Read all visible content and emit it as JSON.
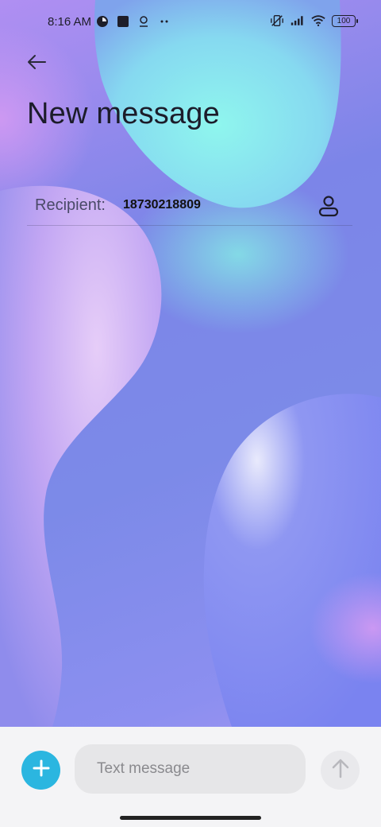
{
  "status_bar": {
    "time": "8:16 AM",
    "left_icons": [
      "notification-app-icon",
      "square-app-icon",
      "location-icon",
      "more-dots-icon"
    ],
    "right_icons": [
      "vibrate-off-icon",
      "signal-icon",
      "wifi-icon"
    ],
    "battery": "100"
  },
  "header": {
    "back_icon": "arrow-left-icon",
    "title": "New message"
  },
  "recipient": {
    "label": "Recipient:",
    "value": "18730218809",
    "contact_icon": "person-icon"
  },
  "composer": {
    "add_icon": "plus-icon",
    "placeholder": "Text message",
    "send_icon": "arrow-up-icon"
  },
  "colors": {
    "accent": "#2bb6e0",
    "title": "#1c1c2a",
    "composer_bg": "#f4f4f6"
  }
}
